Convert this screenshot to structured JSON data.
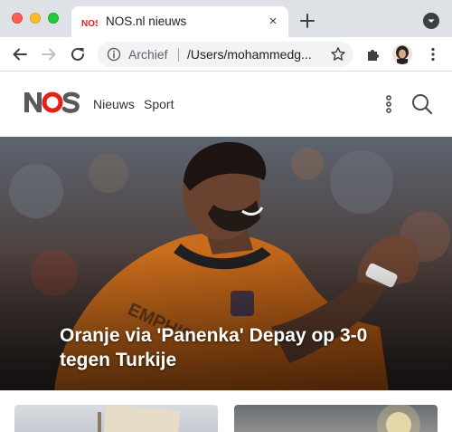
{
  "browser": {
    "tab_title": "NOS.nl nieuws",
    "tab_favicon_text": "NOS",
    "tab_close": "×",
    "omnibox": {
      "security_label": "Archief",
      "url": "/Users/mohammedg..."
    }
  },
  "site": {
    "logo_text": "NOS",
    "brand_color": "#e61e14",
    "nav": [
      {
        "label": "Nieuws"
      },
      {
        "label": "Sport"
      }
    ]
  },
  "hero": {
    "title": "Oranje via 'Panenka' Depay op 3-0 tegen Turkije"
  }
}
